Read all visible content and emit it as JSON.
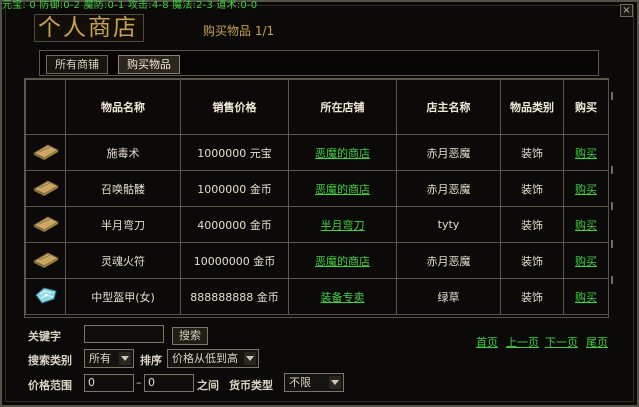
{
  "status_line": "元宝: 0 防御:0-2 魔防:0-1 攻击:4-8 魔法:2-3 道术:0-0",
  "window": {
    "title": "个人商店",
    "subtitle": "购买物品 1/1",
    "close_label": "×"
  },
  "tabs": [
    {
      "label": "所有商铺",
      "active": false
    },
    {
      "label": "购买物品",
      "active": true
    }
  ],
  "table": {
    "headers": [
      "",
      "物品名称",
      "销售价格",
      "所在店铺",
      "店主名称",
      "物品类别",
      "购买"
    ],
    "rows": [
      {
        "icon": "book-icon",
        "name": "施毒术",
        "price": "1000000 元宝",
        "shop": "恶魔的商店",
        "owner": "赤月恶魔",
        "category": "装饰",
        "buy": "购买"
      },
      {
        "icon": "book-icon",
        "name": "召唤骷髅",
        "price": "1000000 金币",
        "shop": "恶魔的商店",
        "owner": "赤月恶魔",
        "category": "装饰",
        "buy": "购买"
      },
      {
        "icon": "book-icon",
        "name": "半月弯刀",
        "price": "4000000 金币",
        "shop": "半月弯刀",
        "owner": "tyty",
        "category": "装饰",
        "buy": "购买"
      },
      {
        "icon": "book-icon",
        "name": "灵魂火符",
        "price": "10000000 金币",
        "shop": "恶魔的商店",
        "owner": "赤月恶魔",
        "category": "装饰",
        "buy": "购买"
      },
      {
        "icon": "armor-icon",
        "name": "中型盔甲(女)",
        "price": "888888888 金币",
        "shop": "装备专卖",
        "owner": "绿草",
        "category": "装饰",
        "buy": "购买"
      }
    ]
  },
  "search": {
    "keyword_label": "关键字",
    "keyword_value": "",
    "search_button": "搜索",
    "type_label": "搜索类别",
    "type_value": "所有",
    "sort_label": "排序",
    "sort_value": "价格从低到高",
    "range_label": "价格范围",
    "range_min": "0",
    "range_sep": "–",
    "range_max": "0",
    "range_between": "之间",
    "currency_label": "货币类型",
    "currency_value": "不限"
  },
  "pagination": {
    "first": "首页",
    "prev": "上一页",
    "next": "下一页",
    "last": "尾页"
  },
  "colors": {
    "gold": "#c7a24e",
    "link_green": "#3fd23f",
    "border": "#5b564b"
  }
}
